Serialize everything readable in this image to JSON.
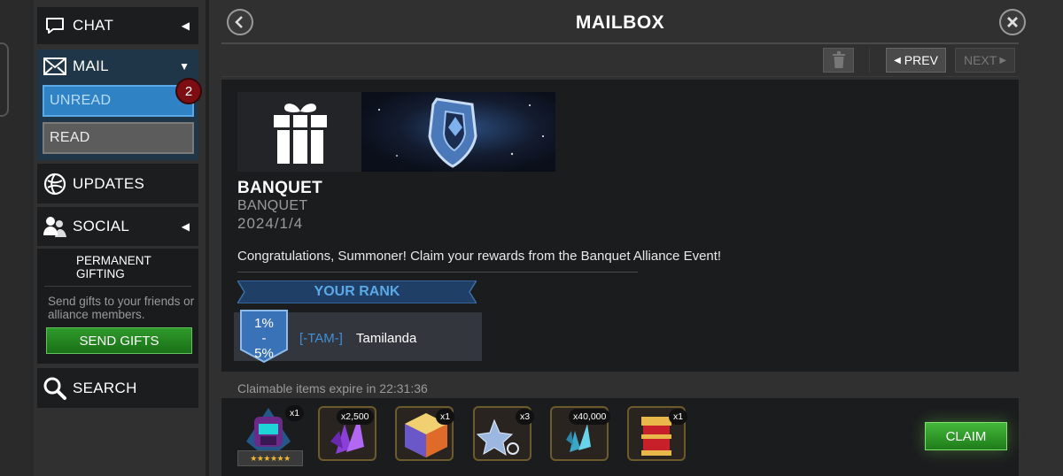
{
  "sidebar": {
    "chat": {
      "label": "CHAT",
      "icon": "chat-bubble-icon"
    },
    "mail": {
      "label": "MAIL",
      "icon": "envelope-icon",
      "unread_label": "UNREAD",
      "read_label": "READ",
      "badge_count": "2"
    },
    "updates": {
      "label": "UPDATES",
      "icon": "globe-icon"
    },
    "social": {
      "label": "SOCIAL",
      "icon": "people-icon"
    },
    "gifting": {
      "title": "PERMANENT GIFTING",
      "description": "Send gifts to your friends or alliance members.",
      "button_label": "SEND GIFTS"
    },
    "search": {
      "label": "SEARCH",
      "icon": "magnifier-icon"
    }
  },
  "header": {
    "title": "MAILBOX"
  },
  "toolbar": {
    "prev_label": "PREV",
    "next_label": "NEXT"
  },
  "message": {
    "title": "BANQUET",
    "subtitle": "BANQUET",
    "date": "2024/1/4",
    "body": "Congratulations, Summoner! Claim your rewards from the Banquet Alliance Event!",
    "rank_label": "YOUR RANK",
    "rank_percent": "1%-5%",
    "alliance_tag": "[-TAM-]",
    "player_name": "Tamilanda"
  },
  "rewards": {
    "expire_text": "Claimable items expire in 22:31:36",
    "items": [
      {
        "name": "champion-crystal",
        "qty": "x1",
        "stars": "★★★★★★"
      },
      {
        "name": "purple-crystal-shards",
        "qty": "x2,500"
      },
      {
        "name": "gold-cube",
        "qty": "x1"
      },
      {
        "name": "star-shard",
        "qty": "x3"
      },
      {
        "name": "catalyst-fragments",
        "qty": "x40,000"
      },
      {
        "name": "red-chest",
        "qty": "x1"
      }
    ],
    "claim_label": "CLAIM"
  },
  "colors": {
    "accent_blue": "#2f83c5",
    "claim_green": "#2e9a2a",
    "badge_red": "#7c0d12",
    "rank_blue": "#1f4f86"
  }
}
